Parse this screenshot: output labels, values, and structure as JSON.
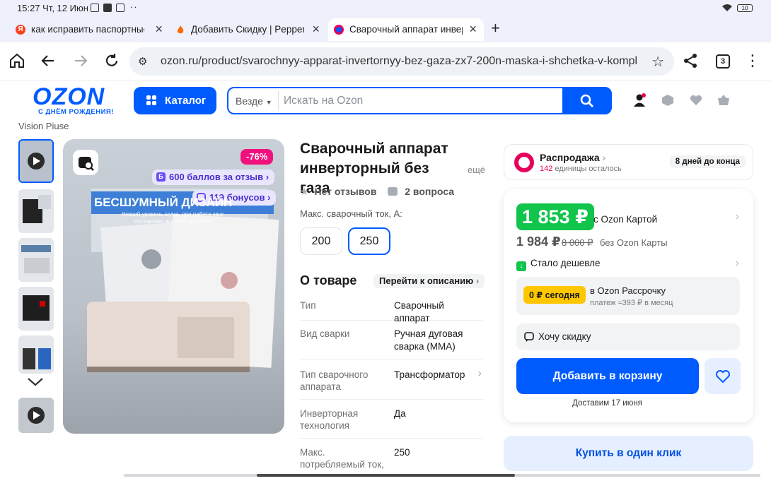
{
  "status": {
    "time": "15:27 Чт, 12 Июн",
    "battery": "10",
    "dots": "··"
  },
  "tabs": [
    {
      "title": "как исправить паспортные",
      "icon": "yandex-icon",
      "color": "#fc3f1d",
      "glyph": "Я"
    },
    {
      "title": "Добавить Скидку | Pepper",
      "icon": "pepper-flame-icon",
      "color": "#ff6a00",
      "glyph": ""
    },
    {
      "title": "Сварочный аппарат инвер",
      "icon": "ozon-favicon",
      "color": "#005bff",
      "glyph": ""
    }
  ],
  "newtab": "+",
  "address": {
    "url": "ozon.ru/product/svarochnyy-apparat-invertornyy-bez-gaza-zx7-200n-maska-i-shchetka-v-kompl",
    "tab_count": "3"
  },
  "header": {
    "logo": "OZON",
    "logo_sub": "С ДНЁМ РОЖДЕНИЯ!",
    "catalog": "Каталог",
    "scope": "Везде",
    "search_placeholder": "Искать на Ozon"
  },
  "product": {
    "brand": "Vision Piuse",
    "discount": "-76%",
    "points": "600 баллов за отзыв",
    "bonus": "119 бонусов",
    "image_text": "БЕСШУМНЫЙ ДИЗАЙН",
    "image_sub": "Низкий уровень шума, при работе звук составляет всего 40 децибел",
    "title": "Сварочный аппарат инверторный без газа",
    "more": "ещё",
    "reviews": "Нет отзывов",
    "questions": "2 вопроса",
    "option_label": "Макс. сварочный ток, А:",
    "options": [
      "200",
      "250"
    ],
    "about": "О товаре",
    "goto": "Перейти к описанию",
    "props": [
      {
        "k": "Тип",
        "v": "Сварочный аппарат"
      },
      {
        "k": "Вид сварки",
        "v": "Ручная дуговая сварка (ММА)"
      },
      {
        "k": "Тип сварочного аппарата",
        "v": "Трансформатор"
      },
      {
        "k": "Инверторная технология",
        "v": "Да"
      },
      {
        "k": "Макс. потребляемый ток,",
        "v": "250"
      }
    ]
  },
  "sale": {
    "title": "Распродажа",
    "count": "142",
    "count_text": "единицы осталось",
    "days": "8 дней до конца"
  },
  "price": {
    "card_price": "1 853 ₽",
    "card_label": "с Ozon Картой",
    "price": "1 984 ₽",
    "old": "8 000 ₽",
    "no_card": "без Ozon Карты",
    "cheaper": "Стало дешевле",
    "today": "0 ₽ сегодня",
    "rassr": "в Ozon Рассрочку",
    "payment": "платеж ≈393 ₽ в месяц",
    "want": "Хочу скидку",
    "add_cart": "Добавить в корзину",
    "delivery": "Доставим 17 июня",
    "one_click": "Купить в один клик"
  },
  "colors": {
    "brand": "#005bff",
    "green": "#10c44c",
    "pink": "#e6005c",
    "yellow": "#ffc700"
  }
}
